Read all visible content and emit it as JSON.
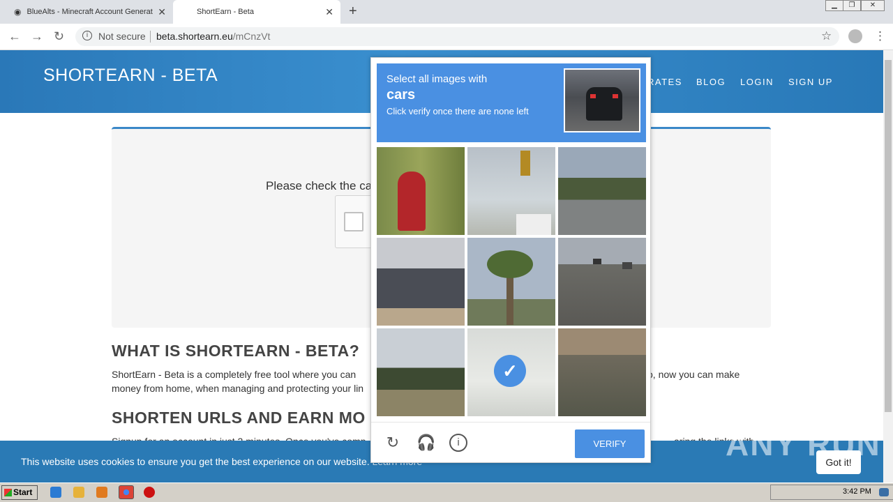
{
  "browser": {
    "tabs": [
      {
        "title": "BlueAlts - Minecraft Account Generat"
      },
      {
        "title": "ShortEarn - Beta"
      }
    ],
    "address": {
      "security": "Not secure",
      "host": "beta.shortearn.eu",
      "path": "/mCnzVt"
    }
  },
  "site": {
    "logo": "SHORTEARN - BETA",
    "nav": [
      "RATES",
      "BLOG",
      "LOGIN",
      "SIGN UP"
    ],
    "check_text": "Please check the ca",
    "h2_1": "WHAT IS SHORTEARN - BETA?",
    "p1a": "ShortEarn - Beta is a completely free tool where you can",
    "p1b": "money from home, when managing and protecting your lin",
    "p1c": "o, now you can make",
    "h2_2": "SHORTEN URLS AND EARN MO",
    "p2": "Signup for an account in just 2 minutes. Once you've comp",
    "p2b": "aring the links with"
  },
  "cookie": {
    "message": "This website uses cookies to ensure you get the best experience on our website.",
    "learn_more": "Learn more",
    "button": "Got it!"
  },
  "watermark": "ANY RUN",
  "captcha": {
    "line1": "Select all images with",
    "target": "cars",
    "line3": "Click verify once there are none left",
    "tiles": [
      "fire hydrant",
      "traffic light",
      "bridge",
      "roof",
      "palm tree",
      "road with cars",
      "palm tree house",
      "road selected",
      "house"
    ],
    "selected_index": 7,
    "verify": "VERIFY"
  },
  "taskbar": {
    "start": "Start",
    "clock": "3:42 PM"
  }
}
